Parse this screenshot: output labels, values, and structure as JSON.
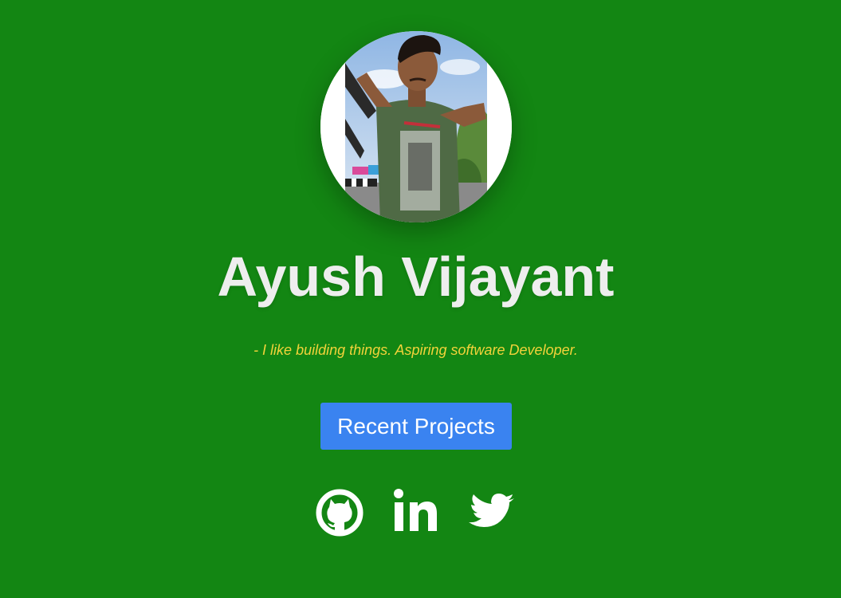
{
  "profile": {
    "name": "Ayush Vijayant",
    "tagline": "- I like building things. Aspiring software Developer.",
    "avatar_icon": "profile-photo"
  },
  "cta": {
    "label": "Recent Projects"
  },
  "socials": [
    {
      "icon": "github-icon"
    },
    {
      "icon": "linkedin-icon"
    },
    {
      "icon": "twitter-icon"
    }
  ],
  "colors": {
    "background": "#138613",
    "name_text": "#eeeeee",
    "tagline_text": "#f2d33a",
    "button_bg": "#3a83f0",
    "button_text": "#ffffff",
    "icons": "#ffffff"
  }
}
